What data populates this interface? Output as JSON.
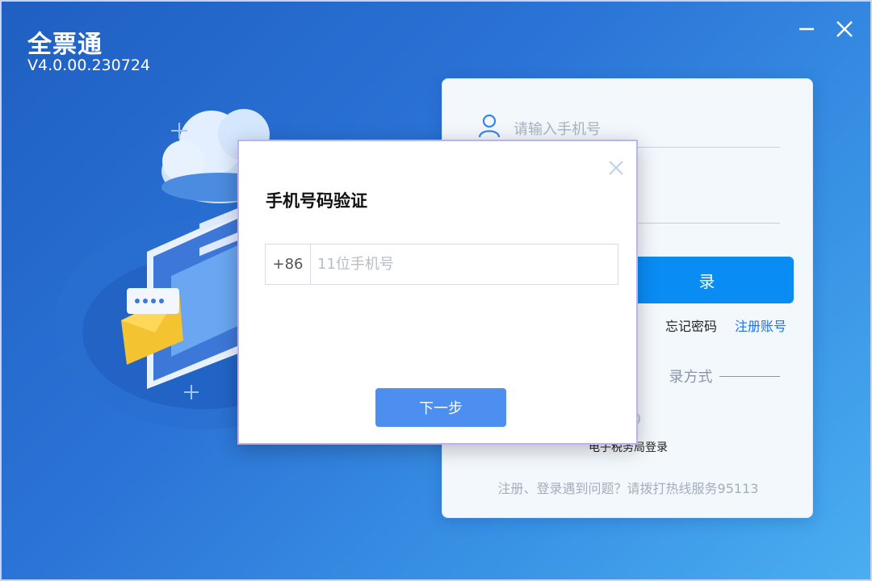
{
  "app": {
    "title": "全票通",
    "version": "V4.0.00.230724"
  },
  "window_controls": {
    "minimize_icon": "minimize-icon",
    "close_icon": "close-icon"
  },
  "login": {
    "phone_placeholder": "请输入手机号",
    "login_button_label": "录",
    "forgot_password": "忘记密码",
    "register": "注册账号",
    "other_methods": "录方式",
    "etax_label": "电子税务局登录",
    "help_text": "注册、登录遇到问题？请拨打热线服务95113"
  },
  "dialog": {
    "title": "手机号码验证",
    "country_code": "+86",
    "phone_placeholder": "11位手机号",
    "next_button": "下一步"
  },
  "colors": {
    "bg_start": "#1f5fc2",
    "bg_end": "#4aaef0",
    "login_button": "#0a8cf5",
    "register_link": "#1a73e8",
    "next_button": "#4d8ff0",
    "dialog_border": "#b9b4f0"
  }
}
